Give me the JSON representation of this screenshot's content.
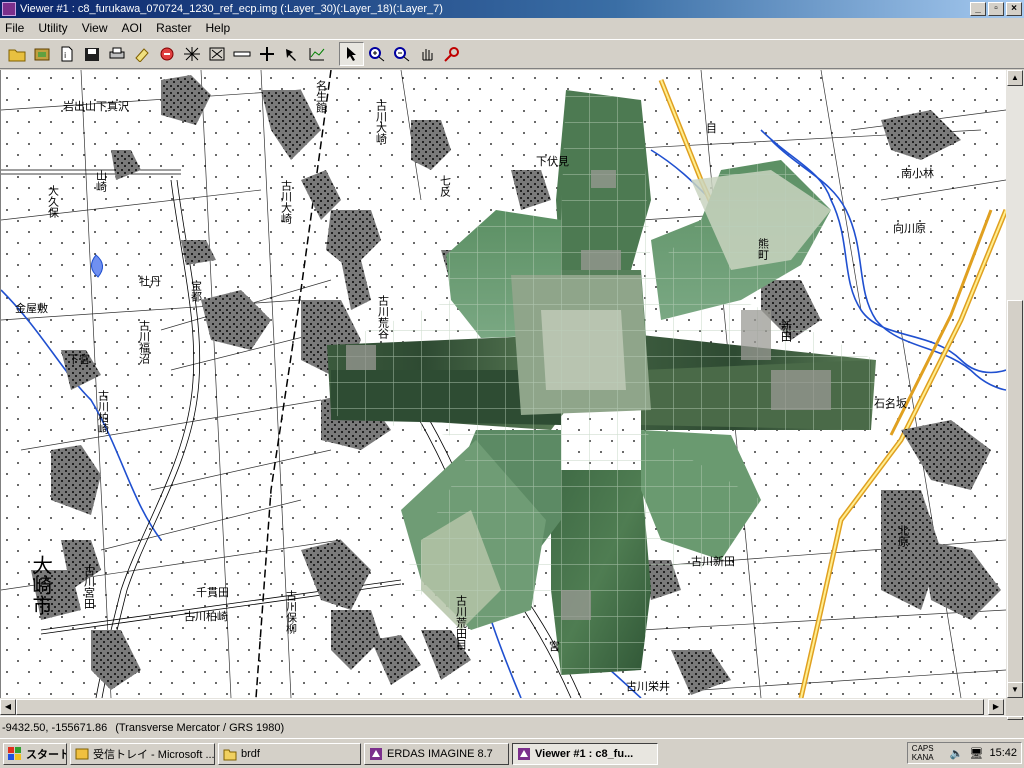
{
  "window": {
    "title": "Viewer #1 : c8_furukawa_070724_1230_ref_ecp.img  (:Layer_30)(:Layer_18)(:Layer_7)",
    "minimize": "_",
    "maximize": "▫",
    "close": "×"
  },
  "menu": [
    "File",
    "Utility",
    "View",
    "AOI",
    "Raster",
    "Help"
  ],
  "toolbar": {
    "icons": [
      "open-folder-icon",
      "open-layer-icon",
      "new-file-icon",
      "save-icon",
      "print-icon",
      "eraser-icon",
      "clear-icon",
      "zoom-extent-icon",
      "fit-window-icon",
      "measure-icon",
      "crosshair-icon",
      "pick-icon",
      "profile-icon",
      "select-arrow-icon",
      "zoom-in-icon",
      "zoom-out-icon",
      "pan-hand-icon",
      "inquire-icon"
    ]
  },
  "map_labels": {
    "l1": "岩出山下真沢",
    "l2": "山崎",
    "l3": "大久保",
    "l4": "名生館",
    "l5": "古川大崎",
    "l6": "下伏見",
    "l7": "七反",
    "l8": "古川大崎",
    "l9": "宝都",
    "l10": "古川荒谷",
    "l11": "金屋敷",
    "l12": "古川福沼",
    "l13": "下宮",
    "l14": "古川柏崎",
    "l15": "大崎市",
    "l16": "古川宮田",
    "l17": "千貫田",
    "l18": "古川柏崎",
    "l19": "古川保柳",
    "l20": "古川荒田目",
    "l21": "古川新田",
    "l22": "古川栄井",
    "l23": "石名坂",
    "l24": "南小林",
    "l25": "向川原",
    "l26": "熊町",
    "l27": "新田",
    "l28": "牡丹",
    "l29": "北原",
    "l30": "宮",
    "l31": "目"
  },
  "status": {
    "coords": "-9432.50, -155671.86",
    "projection": "(Transverse Mercator / GRS 1980)"
  },
  "taskbar": {
    "start": "スタート",
    "tasks": [
      "受信トレイ - Microsoft ...",
      "brdf",
      "ERDAS IMAGINE 8.7",
      "Viewer #1 : c8_fu..."
    ],
    "tray_ime": "CAPS KANA",
    "clock": "15:42"
  }
}
